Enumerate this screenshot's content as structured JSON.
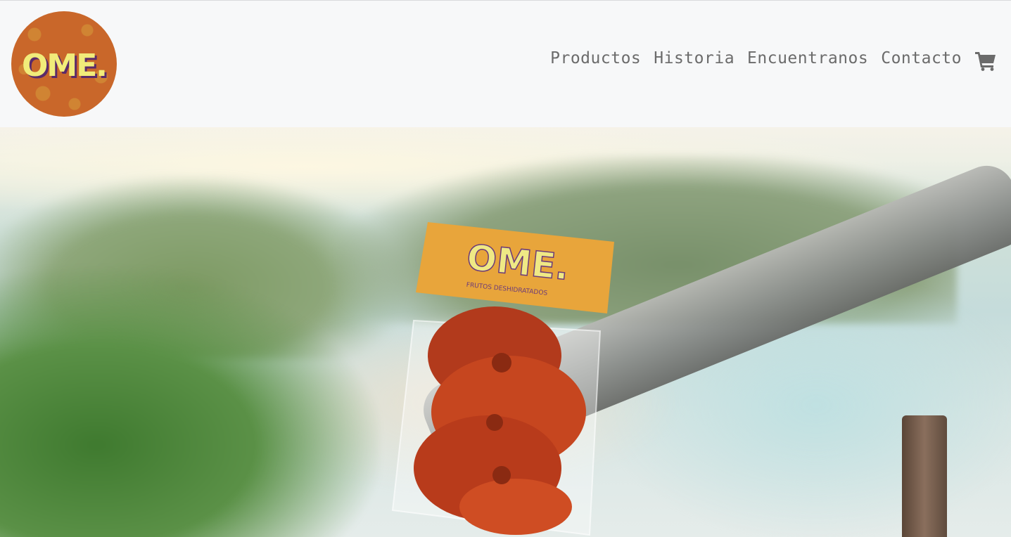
{
  "brand": {
    "logo_text": "OME."
  },
  "nav": {
    "items": [
      {
        "label": "Productos"
      },
      {
        "label": "Historia"
      },
      {
        "label": "Encuentranos"
      },
      {
        "label": "Contacto"
      }
    ],
    "cart_icon": "shopping-cart-icon"
  },
  "hero": {
    "product_label": "OME.",
    "product_sublabel": "FRUTOS DESHIDRATADOS"
  },
  "colors": {
    "nav_text": "#6b6b6b",
    "header_bg": "#f7f8f9",
    "logo_orange": "#c9672a",
    "logo_yellow": "#f1ec7a"
  }
}
